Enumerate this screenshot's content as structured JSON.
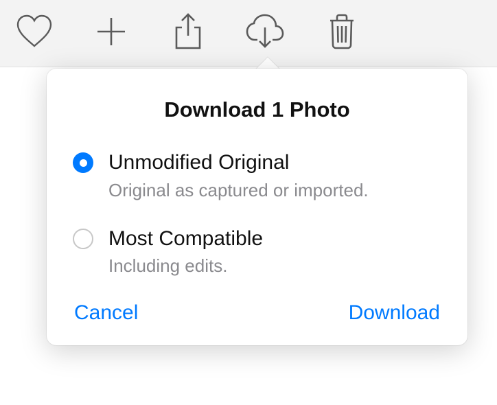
{
  "toolbar": {
    "items": [
      {
        "name": "favorite",
        "icon": "heart-icon"
      },
      {
        "name": "add",
        "icon": "plus-icon"
      },
      {
        "name": "share",
        "icon": "share-icon"
      },
      {
        "name": "download",
        "icon": "download-cloud-icon"
      },
      {
        "name": "delete",
        "icon": "trash-icon"
      }
    ]
  },
  "popover": {
    "title": "Download 1 Photo",
    "options": [
      {
        "label": "Unmodified Original",
        "description": "Original as captured or imported.",
        "selected": true
      },
      {
        "label": "Most Compatible",
        "description": "Including edits.",
        "selected": false
      }
    ],
    "cancel_label": "Cancel",
    "confirm_label": "Download"
  },
  "colors": {
    "accent": "#007aff",
    "text_secondary": "#8a8a8e",
    "toolbar_bg": "#f3f3f3",
    "icon": "#5a5a5a"
  }
}
